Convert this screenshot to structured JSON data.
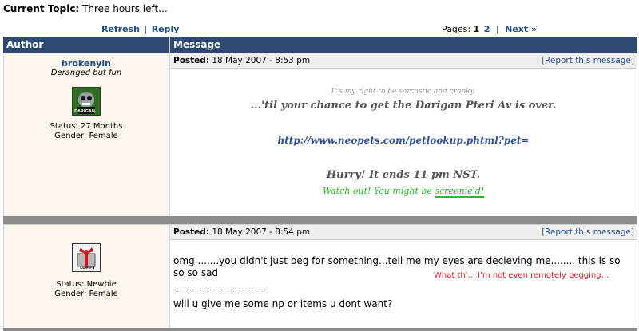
{
  "topic": {
    "label": "Current Topic:",
    "title": "Three hours left..."
  },
  "nav": {
    "refresh": "Refresh",
    "sep": "|",
    "reply": "Reply",
    "pages_label": "Pages:",
    "page_current": "1",
    "page_other": "2",
    "next": "Next »"
  },
  "table": {
    "col_author": "Author",
    "col_message": "Message"
  },
  "posts": [
    {
      "username": "brokenyin",
      "usertitle": "Deranged but fun",
      "status": "Status: 27 Months",
      "gender": "Gender: Female",
      "posted_label": "Posted:",
      "posted_time": "18 May 2007 - 8:53 pm",
      "report_open": "[",
      "report": "Report this message",
      "report_close": "]",
      "sig_line1": "It's my right to be sarcastic and cranky.",
      "sig_line2": "...'til your chance to get the Darigan Pteri Av is over.",
      "sig_link": "http://www.neopets.com/petlookup.phtml?pet=",
      "sig_line3": "Hurry! It ends 11 pm NST.",
      "sig_line4_a": "Watch out! You might be ",
      "sig_line4_b": "screenie'd!",
      "avatar_text": "DARIGAN"
    },
    {
      "username": "",
      "status": "Status: Newbie",
      "gender": "Gender: Female",
      "posted_label": "Posted:",
      "posted_time": "18 May 2007 - 8:54 pm",
      "report_open": "[",
      "report": "Report this message",
      "report_close": "]",
      "line1": "omg........you didn't just beg for something...tell me my eyes are decieving me........ this is so so so sad",
      "aside": "What th'... I'm not even remotely begging...",
      "divider": "--------------------------",
      "line2": "will u give me some np or items u dont want?",
      "avatar_text": "LUMPY"
    }
  ],
  "colors": {
    "header_bg": "#2f4a72",
    "link": "#1f4e8c",
    "author_bg": "#fbf7ec",
    "aside_red": "#e0202a",
    "sig_green": "#22bb22",
    "sig_blue": "#2f4f9a"
  }
}
